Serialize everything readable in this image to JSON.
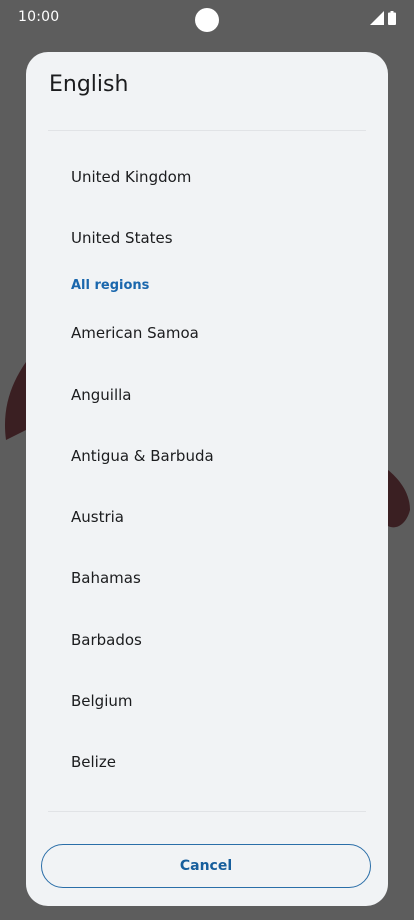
{
  "status_bar": {
    "time": "10:00",
    "icons": [
      "signal-icon",
      "battery-icon"
    ]
  },
  "dialog": {
    "title": "English",
    "suggested": [
      "United Kingdom",
      "United States"
    ],
    "section_header": "All regions",
    "regions": [
      "American Samoa",
      "Anguilla",
      "Antigua & Barbuda",
      "Austria",
      "Bahamas",
      "Barbados",
      "Belgium",
      "Belize"
    ],
    "cancel_label": "Cancel"
  },
  "colors": {
    "scrim": "#5d5d5d",
    "dialog_bg": "#f1f3f5",
    "accent": "#1a67ad",
    "text": "#1b1c1e"
  }
}
